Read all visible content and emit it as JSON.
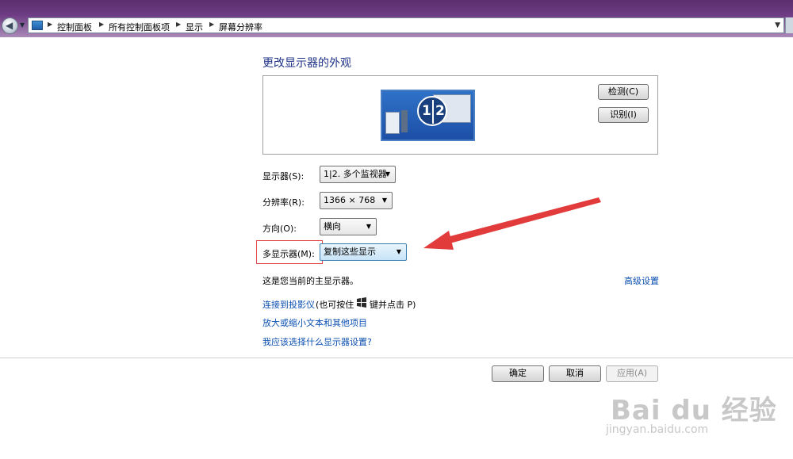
{
  "address": {
    "crumbs": [
      "控制面板",
      "所有控制面板项",
      "显示",
      "屏幕分辨率"
    ]
  },
  "main": {
    "heading": "更改显示器的外观",
    "monitor_left_number": "1",
    "monitor_right_number": "2",
    "detect_label": "检测(C)",
    "identify_label": "识别(I)"
  },
  "settings": {
    "display_label": "显示器(S):",
    "display_value": "1|2. 多个监视器",
    "resolution_label": "分辨率(R):",
    "resolution_value": "1366 × 768",
    "orientation_label": "方向(O):",
    "orientation_value": "横向",
    "multi_label": "多显示器(M):",
    "multi_value": "复制这些显示"
  },
  "info": {
    "primary_text": "这是您当前的主显示器。",
    "advanced_link": "高级设置",
    "projector_link": "连接到投影仪",
    "projector_hint_a": "(也可按住",
    "projector_hint_b": "键并点击 P)",
    "text_size_link": "放大或缩小文本和其他项目",
    "which_settings_link": "我应该选择什么显示器设置?"
  },
  "footer": {
    "ok_label": "确定",
    "cancel_label": "取消",
    "apply_label": "应用(A)"
  },
  "watermark": {
    "main": "Bai du 经验",
    "sub": "jingyan.baidu.com"
  },
  "colors": {
    "heading": "#1e3287",
    "link": "#0b4fb0",
    "annotation": "#e24a4a"
  }
}
